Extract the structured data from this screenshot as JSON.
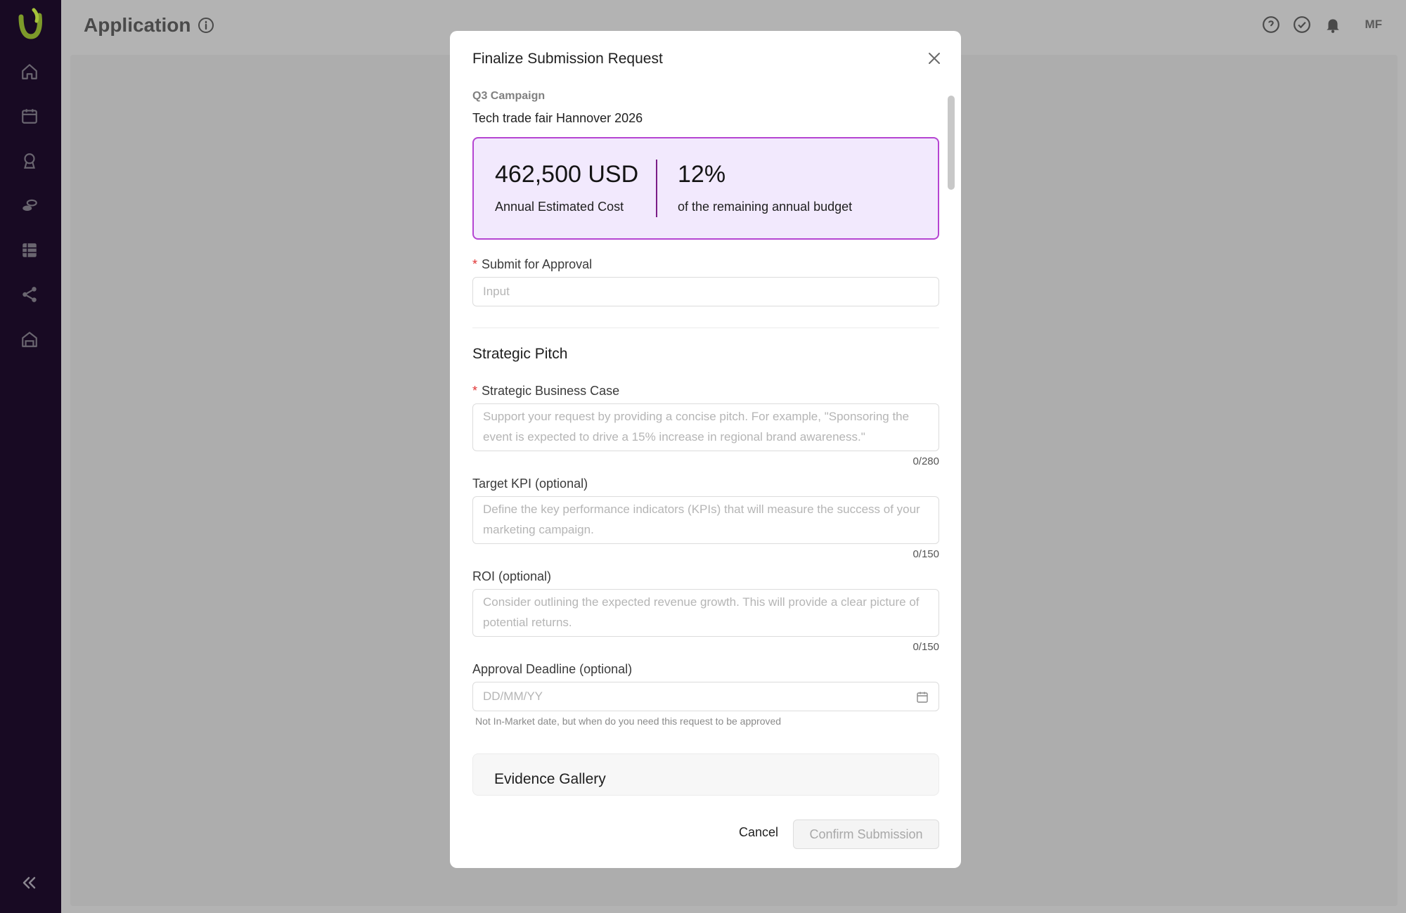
{
  "header": {
    "title": "Application",
    "avatar_initials": "MF"
  },
  "sidebar": {
    "items": [
      {
        "icon": "home-icon"
      },
      {
        "icon": "calendar-icon"
      },
      {
        "icon": "award-icon"
      },
      {
        "icon": "coins-icon"
      },
      {
        "icon": "table-icon"
      },
      {
        "icon": "share-icon"
      },
      {
        "icon": "warehouse-icon"
      }
    ]
  },
  "modal": {
    "title": "Finalize Submission Request",
    "kicker": "Q3 Campaign",
    "subtitle": "Tech trade fair Hannover 2026",
    "cost": {
      "value": "462,500 USD",
      "label": "Annual Estimated Cost",
      "percent": "12%",
      "percent_label": "of the remaining annual budget"
    },
    "approval": {
      "label": "Submit for Approval",
      "placeholder": "Input"
    },
    "section_title": "Strategic Pitch",
    "business_case": {
      "label": "Strategic Business Case",
      "placeholder": "Support your request by providing a concise pitch. For example, \"Sponsoring the event is expected to drive a 15% increase in regional brand awareness.\"",
      "counter": "0/280"
    },
    "kpi": {
      "label": "Target KPI (optional)",
      "placeholder": "Define the key performance indicators (KPIs) that will measure the success of your marketing campaign.",
      "counter": "0/150"
    },
    "roi": {
      "label": "ROI (optional)",
      "placeholder": "Consider outlining the expected revenue growth. This will provide a clear picture of potential returns.",
      "counter": "0/150"
    },
    "deadline": {
      "label": "Approval Deadline (optional)",
      "placeholder": "DD/MM/YY",
      "hint": "Not In-Market date, but when do you need this request to be approved"
    },
    "gallery_title": "Evidence Gallery",
    "cancel_label": "Cancel",
    "confirm_label": "Confirm Submission"
  },
  "colors": {
    "sidebar": "#180a23",
    "accent": "#b545d2",
    "card_bg": "#f2e9fd",
    "required": "#e03434"
  }
}
